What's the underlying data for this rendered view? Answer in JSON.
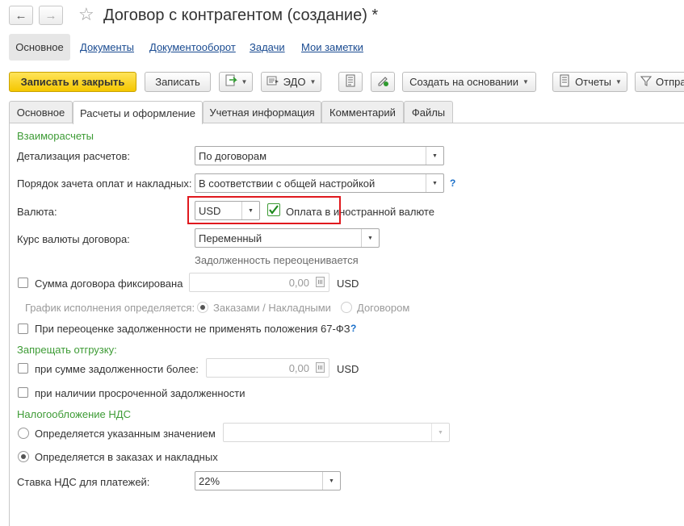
{
  "window": {
    "title": "Договор с контрагентом (создание) *"
  },
  "nav": {
    "active": "Основное",
    "links": [
      "Документы",
      "Документооборот",
      "Задачи",
      "Мои заметки"
    ]
  },
  "toolbar": {
    "save_close": "Записать и закрыть",
    "save": "Записать",
    "edo": "ЭДО",
    "create_based_on": "Создать на основании",
    "reports": "Отчеты",
    "send": "Отпра"
  },
  "tabs": [
    "Основное",
    "Расчеты и оформление",
    "Учетная информация",
    "Комментарий",
    "Файлы"
  ],
  "active_tab": "Расчеты и оформление",
  "settlements": {
    "section": "Взаиморасчеты",
    "detail_label": "Детализация расчетов:",
    "detail_value": "По договорам",
    "offset_label": "Порядок зачета оплат и накладных:",
    "offset_value": "В соответствии с общей настройкой",
    "help": "?",
    "currency_label": "Валюта:",
    "currency_value": "USD",
    "foreign_payment_label": "Оплата в иностранной валюте",
    "foreign_payment_checked": true,
    "rate_label": "Курс валюты договора:",
    "rate_value": "Переменный",
    "rate_note": "Задолженность переоценивается",
    "fixed_sum_label": "Сумма договора фиксирована",
    "fixed_sum_value": "0,00",
    "fixed_sum_currency": "USD",
    "schedule_label": "График исполнения определяется:",
    "schedule_opt1": "Заказами / Накладными",
    "schedule_opt2": "Договором",
    "revaluation_label": "При переоценке задолженности не применять положения 67-ФЗ",
    "revaluation_help": "?"
  },
  "shipping": {
    "section": "Запрещать отгрузку:",
    "debt_label": "при сумме задолженности более:",
    "debt_value": "0,00",
    "debt_currency": "USD",
    "overdue_label": "при наличии просроченной задолженности"
  },
  "vat": {
    "section": "Налогообложение НДС",
    "opt_specified": "Определяется указанным значением",
    "opt_orders": "Определяется в заказах и накладных",
    "rate_label": "Ставка НДС для платежей:",
    "rate_value": "22%"
  }
}
